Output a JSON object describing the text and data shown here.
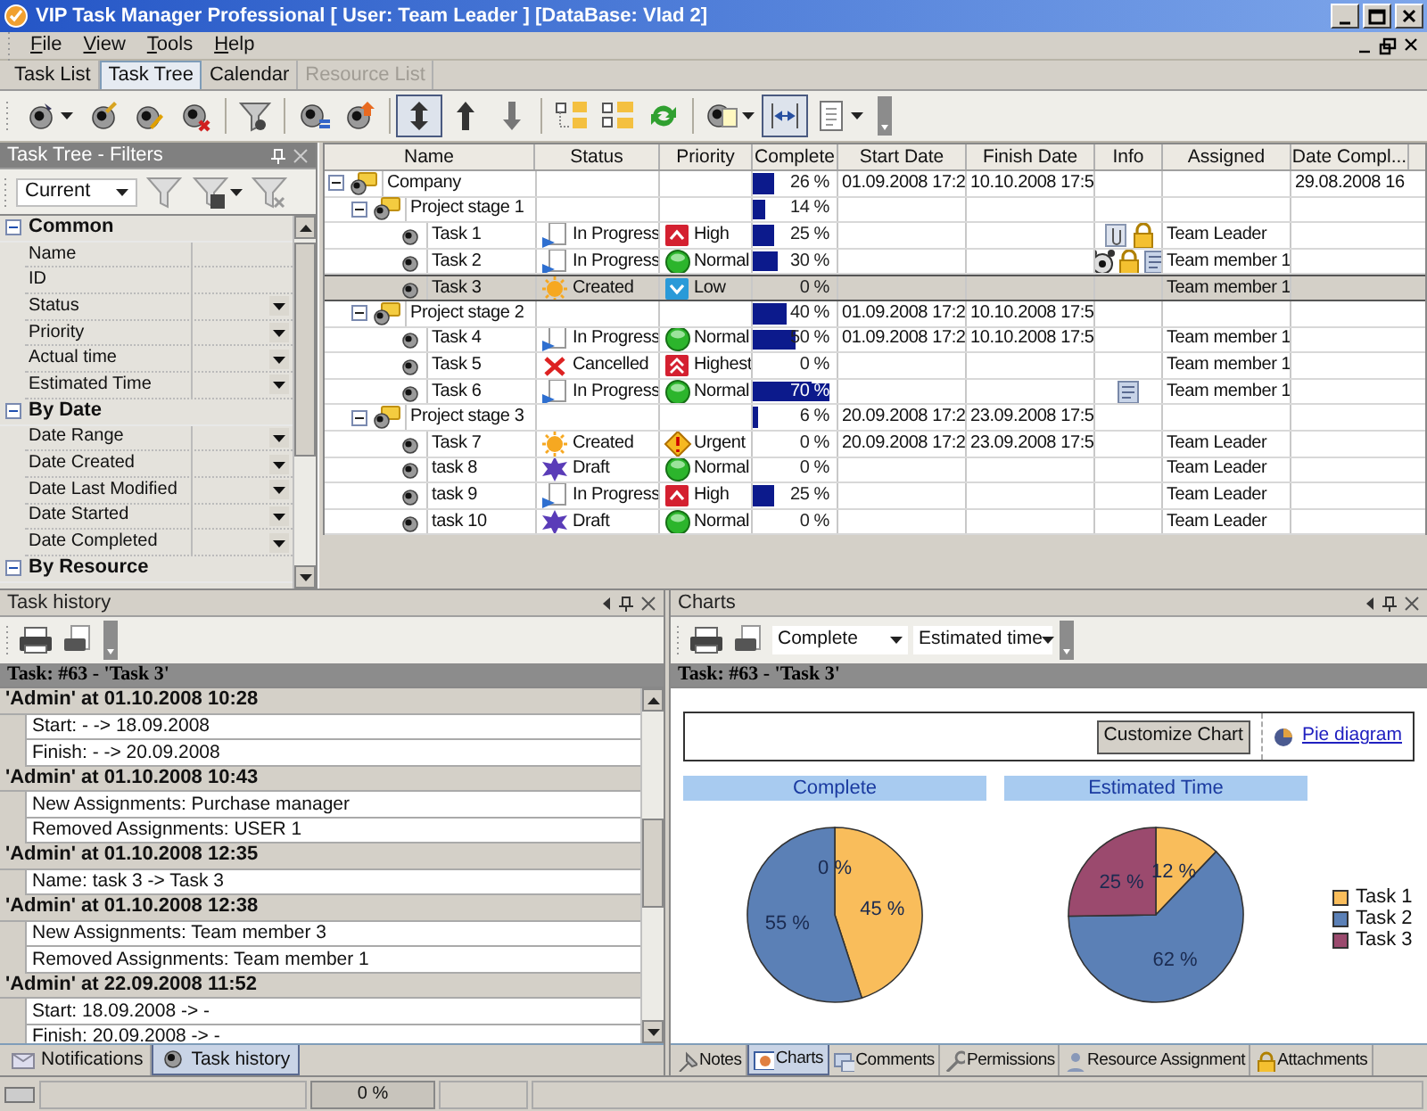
{
  "window": {
    "title": "VIP Task Manager Professional [ User: Team Leader ] [DataBase: Vlad 2]"
  },
  "menu": [
    {
      "label": "File"
    },
    {
      "label": "View"
    },
    {
      "label": "Tools"
    },
    {
      "label": "Help"
    }
  ],
  "view_tabs": [
    {
      "label": "Task List",
      "selected": false,
      "disabled": false
    },
    {
      "label": "Task Tree",
      "selected": true,
      "disabled": false
    },
    {
      "label": "Calendar",
      "selected": false,
      "disabled": false
    },
    {
      "label": "Resource List",
      "selected": false,
      "disabled": true
    }
  ],
  "toolbar": [
    {
      "pressed": false
    },
    {
      "pressed": false
    },
    {
      "pressed": false
    },
    {
      "pressed": false
    },
    {
      "pressed": false
    },
    {
      "pressed": false
    },
    {
      "pressed": false
    },
    {
      "pressed": true
    },
    {
      "pressed": false
    },
    {
      "pressed": false
    },
    {
      "pressed": false
    },
    {
      "pressed": false
    },
    {
      "pressed": false
    },
    {
      "pressed": false
    },
    {
      "pressed": true
    },
    {
      "pressed": false
    }
  ],
  "filters": {
    "title": "Task Tree - Filters",
    "active": true,
    "preset": "Current",
    "categories": [
      {
        "label": "Common",
        "expanded": true,
        "children": [
          {
            "label": "Name",
            "dropdown": false
          },
          {
            "label": "ID",
            "dropdown": false
          },
          {
            "label": "Status",
            "dropdown": true
          },
          {
            "label": "Priority",
            "dropdown": true
          },
          {
            "label": "Actual time",
            "dropdown": true
          },
          {
            "label": "Estimated Time",
            "dropdown": true
          }
        ]
      },
      {
        "label": "By Date",
        "expanded": true,
        "children": [
          {
            "label": "Date Range",
            "dropdown": true
          },
          {
            "label": "Date Created",
            "dropdown": true
          },
          {
            "label": "Date Last Modified",
            "dropdown": true
          },
          {
            "label": "Date Started",
            "dropdown": true
          },
          {
            "label": "Date Completed",
            "dropdown": true
          }
        ]
      },
      {
        "label": "By Resource",
        "expanded": true
      }
    ]
  },
  "grid": {
    "columns": [
      "Name",
      "Status",
      "Priority",
      "Complete",
      "Start Date",
      "Finish Date",
      "Info",
      "Assigned",
      "Date Compl..."
    ],
    "rows": [
      {
        "name": "Company",
        "kind": "group",
        "expanded": true,
        "selected": false,
        "complete": "26 %",
        "level": 0.26,
        "start": "01.09.2008 17:2",
        "finish": "10.10.2008 17:5",
        "date_completed": "29.08.2008 16",
        "children": [
          {
            "name": "Project stage 1",
            "kind": "group",
            "expanded": true,
            "selected": false,
            "complete": "14 %",
            "level": 0.14,
            "children": [
              {
                "name": "Task 1",
                "kind": "task",
                "selected": false,
                "status": {
                  "label": "In Progress",
                  "kind": "in_progress"
                },
                "priority": {
                  "label": "High",
                  "kind": "high"
                },
                "complete": "25 %",
                "level": 0.25,
                "info": [
                  {
                    "kind": "attachment"
                  },
                  {
                    "kind": "lock"
                  }
                ],
                "assigned": "Team Leader"
              },
              {
                "name": "Task 2",
                "kind": "task",
                "selected": false,
                "status": {
                  "label": "In Progress",
                  "kind": "in_progress"
                },
                "priority": {
                  "label": "Normal",
                  "kind": "normal"
                },
                "complete": "30 %",
                "level": 0.3,
                "info": [
                  {
                    "kind": "alarm"
                  },
                  {
                    "kind": "lock"
                  },
                  {
                    "kind": "note"
                  }
                ],
                "assigned": "Team member 1"
              },
              {
                "name": "Task 3",
                "kind": "task",
                "selected": true,
                "status": {
                  "label": "Created",
                  "kind": "created"
                },
                "priority": {
                  "label": "Low",
                  "kind": "low"
                },
                "complete": "0 %",
                "assigned": "Team member 1"
              }
            ]
          },
          {
            "name": "Project stage 2",
            "kind": "group",
            "expanded": true,
            "selected": false,
            "complete": "40 %",
            "level": 0.4,
            "start": "01.09.2008 17:2",
            "finish": "10.10.2008 17:5",
            "children": [
              {
                "name": "Task 4",
                "kind": "task",
                "selected": false,
                "status": {
                  "label": "In Progress",
                  "kind": "in_progress"
                },
                "priority": {
                  "label": "Normal",
                  "kind": "normal"
                },
                "complete": "50 %",
                "level": 0.5,
                "start": "01.09.2008 17:2",
                "finish": "10.10.2008 17:5",
                "assigned": "Team member 1"
              },
              {
                "name": "Task 5",
                "kind": "task",
                "selected": false,
                "status": {
                  "label": "Cancelled",
                  "kind": "cancelled"
                },
                "priority": {
                  "label": "Highest",
                  "kind": "highest"
                },
                "complete": "0 %",
                "assigned": "Team member 1"
              },
              {
                "name": "Task 6",
                "kind": "task",
                "selected": false,
                "status": {
                  "label": "In Progress",
                  "kind": "in_progress"
                },
                "priority": {
                  "label": "Normal",
                  "kind": "normal"
                },
                "complete": "70 %",
                "level": 0.7,
                "info": [
                  {
                    "kind": "note"
                  }
                ],
                "assigned": "Team member 1"
              }
            ]
          },
          {
            "name": "Project stage 3",
            "kind": "group",
            "expanded": true,
            "selected": false,
            "complete": "6 %",
            "level": 0.06,
            "start": "20.09.2008 17:2",
            "finish": "23.09.2008 17:5",
            "children": [
              {
                "name": "Task 7",
                "kind": "task",
                "selected": false,
                "status": {
                  "label": "Created",
                  "kind": "created"
                },
                "priority": {
                  "label": "Urgent",
                  "kind": "urgent"
                },
                "complete": "0 %",
                "start": "20.09.2008 17:2",
                "finish": "23.09.2008 17:5",
                "assigned": "Team Leader"
              },
              {
                "name": "task 8",
                "kind": "task",
                "selected": false,
                "status": {
                  "label": "Draft",
                  "kind": "draft"
                },
                "priority": {
                  "label": "Normal",
                  "kind": "normal"
                },
                "complete": "0 %",
                "assigned": "Team Leader"
              },
              {
                "name": "task 9",
                "kind": "task",
                "selected": false,
                "status": {
                  "label": "In Progress",
                  "kind": "in_progress"
                },
                "priority": {
                  "label": "High",
                  "kind": "high"
                },
                "complete": "25 %",
                "level": 0.25,
                "assigned": "Team Leader"
              },
              {
                "name": "task 10",
                "kind": "task",
                "selected": false,
                "status": {
                  "label": "Draft",
                  "kind": "draft"
                },
                "priority": {
                  "label": "Normal",
                  "kind": "normal"
                },
                "complete": "0 %",
                "assigned": "Team Leader"
              }
            ]
          }
        ]
      }
    ]
  },
  "history": {
    "title": "Task history",
    "active": false,
    "task": "Task: #63 - 'Task 3'",
    "entries": [
      {
        "header": "'Admin' at 01.10.2008 10:28",
        "changes": [
          "Start: - -> 18.09.2008",
          "Finish: - -> 20.09.2008"
        ]
      },
      {
        "header": "'Admin' at 01.10.2008 10:43",
        "changes": [
          "New Assignments: Purchase manager",
          "Removed Assignments: USER 1"
        ]
      },
      {
        "header": "'Admin' at 01.10.2008 12:35",
        "changes": [
          "Name: task 3 -> Task 3"
        ]
      },
      {
        "header": "'Admin' at 01.10.2008 12:38",
        "changes": [
          "New Assignments: Team member 3",
          "Removed Assignments: Team member 1"
        ]
      },
      {
        "header": "'Admin' at 22.09.2008 11:52",
        "changes": [
          "Start: 18.09.2008 -> -",
          "Finish: 20.09.2008 -> -"
        ]
      }
    ],
    "tabs": [
      {
        "label": "Notifications",
        "selected": false
      },
      {
        "label": "Task history",
        "selected": true
      }
    ]
  },
  "charts": {
    "title": "Charts",
    "active": false,
    "selectors": [
      "Complete",
      "Estimated time"
    ],
    "task": "Task: #63 - 'Task 3'",
    "customize_button": "Customize Chart",
    "diagram_link": "Pie diagram",
    "pies": [
      {
        "chart_data": {
          "type": "pie",
          "title": "Complete",
          "values": [
            45,
            55,
            0
          ],
          "value_labels": [
            "45 %",
            "55 %",
            "0 %"
          ]
        }
      },
      {
        "chart_data": {
          "type": "pie",
          "title": "Estimated Time",
          "values": [
            12,
            62,
            25
          ],
          "value_labels": [
            "12 %",
            "62 %",
            "25 %"
          ]
        }
      }
    ],
    "legend": [
      {
        "label": "Task 1",
        "color": "#f9bd5b"
      },
      {
        "label": "Task 2",
        "color": "#5b80b6"
      },
      {
        "label": "Task 3",
        "color": "#9b4a6e"
      }
    ],
    "tabs": [
      {
        "label": "Notes",
        "selected": false
      },
      {
        "label": "Charts",
        "selected": true
      },
      {
        "label": "Comments",
        "selected": false
      },
      {
        "label": "Permissions",
        "selected": false
      },
      {
        "label": "Resource Assignment",
        "selected": false
      },
      {
        "label": "Attachments",
        "selected": false
      }
    ]
  },
  "status_bar": {
    "progress": "0 %"
  }
}
